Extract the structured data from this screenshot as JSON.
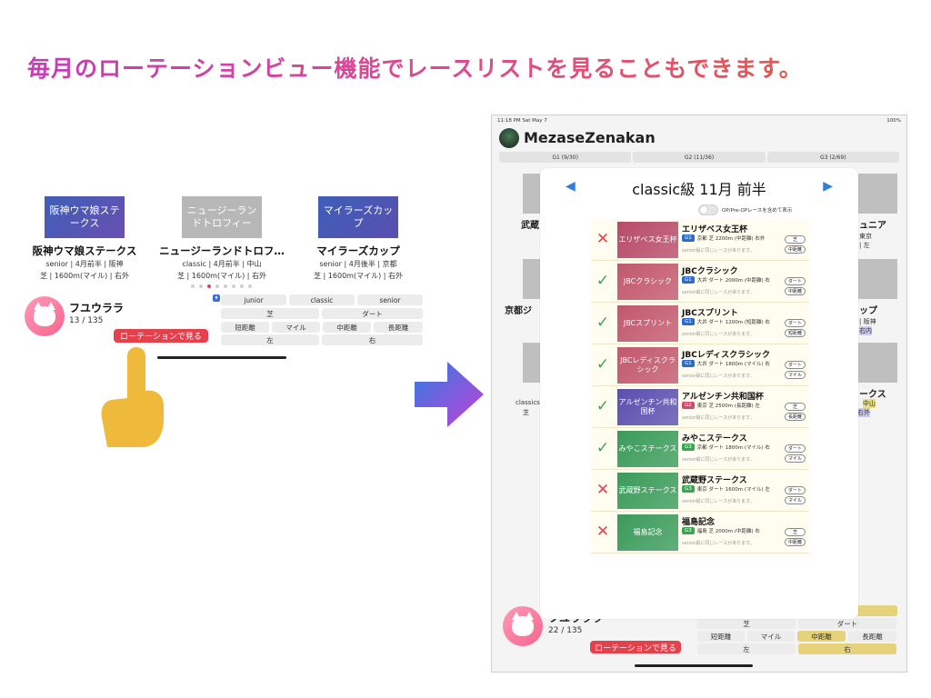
{
  "headline": "毎月のローテーションビュー機能でレースリストを見ることもできます。",
  "phone": {
    "cards": [
      {
        "thumb": "阪神ウマ娘ステークス",
        "name": "阪神ウマ娘ステークス",
        "line1": "senior | 4月前半 | 阪神",
        "line2": "芝 | 1600m(マイル) | 右外",
        "color": "#3d5fb8"
      },
      {
        "thumb": "ニュージーランドトロフィー",
        "name": "ニュージーランドトロフ…",
        "line1": "classic | 4月前半 | 中山",
        "line2": "芝 | 1600m(マイル) | 右外",
        "color": "#b7b7b7"
      },
      {
        "thumb": "マイラーズカップ",
        "name": "マイラーズカップ",
        "line1": "senior | 4月後半 | 京都",
        "line2": "芝 | 1600m(マイル) | 右外",
        "color": "#3d5fb8"
      }
    ],
    "user": {
      "name": "フユウララ",
      "count": "13 / 135"
    },
    "rotation_button": "ローテーションで見る",
    "seg_row1": [
      "junior",
      "classic",
      "senior"
    ],
    "seg_row2": [
      "芝",
      "ダート"
    ],
    "seg_row3": [
      "短距離",
      "マイル",
      "中距離",
      "長距離"
    ],
    "seg_row4": [
      "左",
      "右"
    ],
    "filter_badge": "♦"
  },
  "tablet": {
    "status_time": "11:18 PM   Sat May 7",
    "battery": "100%",
    "app_title": "MezaseZenakan",
    "grade_tabs": [
      "G1 (9/30)",
      "G2 (11/36)",
      "G3 (2/69)"
    ],
    "bg_left_texts": [
      "武蔵",
      "京都ジ",
      "classics",
      "芝"
    ],
    "bg_right_texts": [
      "ュニア",
      "ップ",
      "ークス",
      "東京",
      "| 左",
      "| 阪神",
      "右内",
      "中山",
      "右外"
    ],
    "user": {
      "name": "フユウララ",
      "count": "22 / 135"
    },
    "rotation_button": "ローテーションで見る",
    "seg_row1": [
      "senior"
    ],
    "seg_row2": [
      "芝",
      "ダート"
    ],
    "seg_row3": [
      "短距離",
      "マイル",
      "中距離",
      "長距離"
    ],
    "seg_row4": [
      "左",
      "右"
    ],
    "modal": {
      "prev": "◀",
      "next": "▶",
      "title": "classic級 11月 前半",
      "toggle_label": "OP/Pre-OPレースを含めて表示",
      "races": [
        {
          "mark": "✕",
          "ok": false,
          "thumb": "エリザベス女王杯",
          "thumb_color": "#b84a6a",
          "name": "エリザベス女王杯",
          "grade": "G1",
          "grade_color": "#2d6ccf",
          "info": "京都 芝 2200m (中距離) 右外",
          "note": "senior級に同じレースがあります。",
          "pills": [
            "芝",
            "中距離"
          ]
        },
        {
          "mark": "✓",
          "ok": true,
          "thumb": "JBCクラシック",
          "thumb_color": "#c2586e",
          "name": "JBCクラシック",
          "grade": "G1",
          "grade_color": "#2d6ccf",
          "info": "大井 ダート 2000m (中距離) 右",
          "note": "senior級に同じレースがあります。",
          "pills": [
            "ダート",
            "中距離"
          ]
        },
        {
          "mark": "✓",
          "ok": true,
          "thumb": "JBCスプリント",
          "thumb_color": "#c2586e",
          "name": "JBCスプリント",
          "grade": "G1",
          "grade_color": "#2d6ccf",
          "info": "大井 ダート 1200m (短距離) 右",
          "note": "senior級に同じレースがあります。",
          "pills": [
            "ダート",
            "短距離"
          ]
        },
        {
          "mark": "✓",
          "ok": true,
          "thumb": "JBCレディスクラシック",
          "thumb_color": "#c2586e",
          "name": "JBCレディスクラシック",
          "grade": "G1",
          "grade_color": "#2d6ccf",
          "info": "大井 ダート 1800m (マイル) 右",
          "note": "senior級に同じレースがあります。",
          "pills": [
            "ダート",
            "マイル"
          ]
        },
        {
          "mark": "✓",
          "ok": true,
          "thumb": "アルゼンチン共和国杯",
          "thumb_color": "#5a4fb0",
          "name": "アルゼンチン共和国杯",
          "grade": "G2",
          "grade_color": "#d8456f",
          "info": "東京 芝 2500m (長距離) 左",
          "note": "senior級に同じレースがあります。",
          "pills": [
            "芝",
            "長距離"
          ]
        },
        {
          "mark": "✓",
          "ok": true,
          "thumb": "みやこステークス",
          "thumb_color": "#3a9b5b",
          "name": "みやこステークス",
          "grade": "G3",
          "grade_color": "#3aa552",
          "info": "京都 ダート 1800m (マイル) 右",
          "note": "senior級に同じレースがあります。",
          "pills": [
            "ダート",
            "マイル"
          ]
        },
        {
          "mark": "✕",
          "ok": false,
          "thumb": "武蔵野ステークス",
          "thumb_color": "#3a9b5b",
          "name": "武蔵野ステークス",
          "grade": "G3",
          "grade_color": "#3aa552",
          "info": "東京 ダート 1600m (マイル) 左",
          "note": "senior級に同じレースがあります。",
          "pills": [
            "ダート",
            "マイル"
          ]
        },
        {
          "mark": "✕",
          "ok": false,
          "thumb": "福島記念",
          "thumb_color": "#3a9b5b",
          "name": "福島記念",
          "grade": "G3",
          "grade_color": "#3aa552",
          "info": "福島 芝 2000m (中距離) 右",
          "note": "senior級に同じレースがあります。",
          "pills": [
            "芝",
            "中距離"
          ]
        }
      ]
    }
  },
  "colors": {
    "accent_red": "#e4414d",
    "ok_green": "#3aa552",
    "nav_blue": "#2f7de1"
  }
}
